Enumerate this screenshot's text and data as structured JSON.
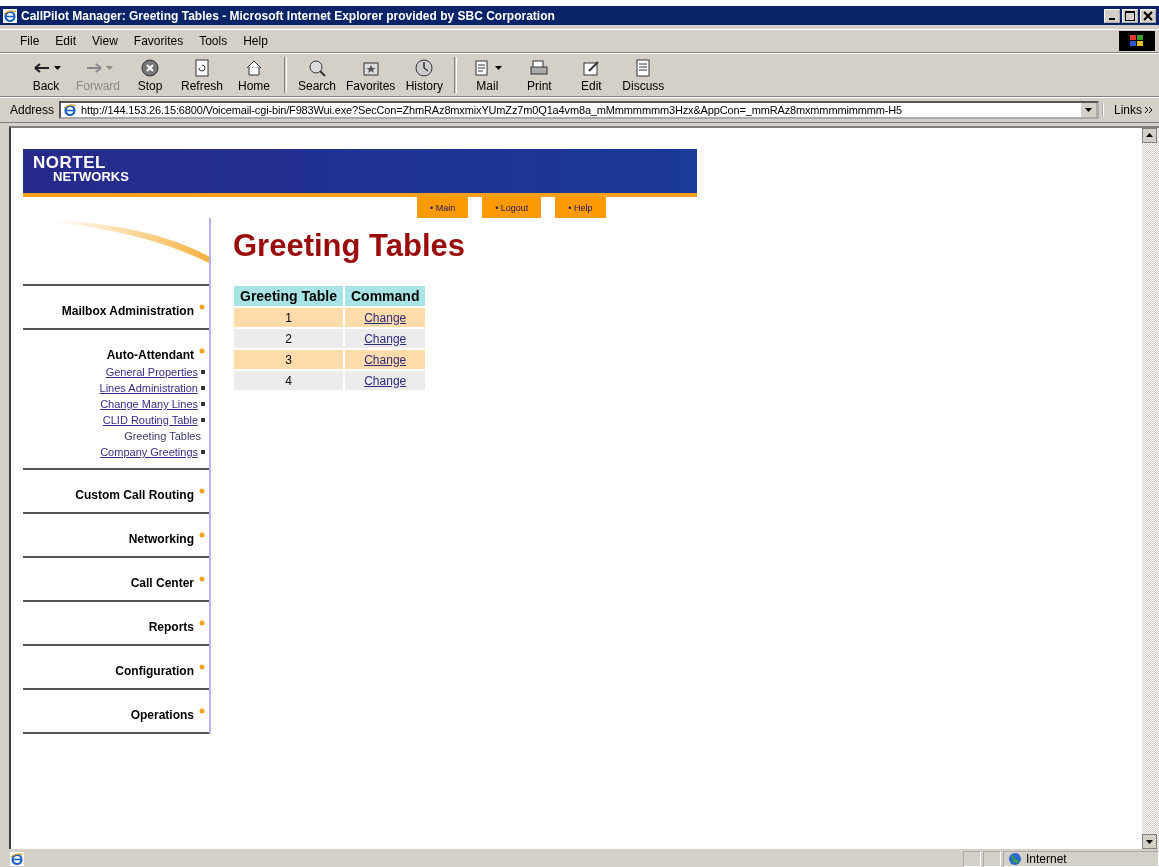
{
  "window": {
    "title": "CallPilot Manager: Greeting Tables - Microsoft Internet Explorer provided by SBC Corporation"
  },
  "menu": [
    {
      "label": "File"
    },
    {
      "label": "Edit"
    },
    {
      "label": "View"
    },
    {
      "label": "Favorites"
    },
    {
      "label": "Tools"
    },
    {
      "label": "Help"
    }
  ],
  "toolbar": [
    {
      "label": "Back",
      "kind": "back",
      "disabled": false,
      "dropdown": true
    },
    {
      "label": "Forward",
      "kind": "forward",
      "disabled": true,
      "dropdown": true
    },
    {
      "label": "Stop",
      "kind": "stop",
      "disabled": false,
      "dropdown": false
    },
    {
      "label": "Refresh",
      "kind": "refresh",
      "disabled": false,
      "dropdown": false
    },
    {
      "label": "Home",
      "kind": "home",
      "disabled": false,
      "dropdown": false
    },
    {
      "label": "Search",
      "kind": "search",
      "disabled": false,
      "dropdown": false
    },
    {
      "label": "Favorites",
      "kind": "favorites",
      "disabled": false,
      "dropdown": false
    },
    {
      "label": "History",
      "kind": "history",
      "disabled": false,
      "dropdown": false
    },
    {
      "label": "Mail",
      "kind": "mail",
      "disabled": false,
      "dropdown": true
    },
    {
      "label": "Print",
      "kind": "print",
      "disabled": false,
      "dropdown": false
    },
    {
      "label": "Edit",
      "kind": "edit",
      "disabled": false,
      "dropdown": false
    },
    {
      "label": "Discuss",
      "kind": "discuss",
      "disabled": false,
      "dropdown": false
    }
  ],
  "address": {
    "label": "Address",
    "value": "http://144.153.26.15:6800/Voicemail-cgi-bin/F983Wui.exe?SecCon=ZhmRAz8mxmixYUmZz7m0Q1a4vm8a_mMmmmmmm3Hzx&AppCon=_mmRAz8mxmmmmimmmm-H5",
    "links": "Links"
  },
  "banner": {
    "logo_top": "NORTEL",
    "logo_bottom": "NETWORKS"
  },
  "nav": [
    {
      "label": "• Main"
    },
    {
      "label": "• Logout"
    },
    {
      "label": "• Help"
    }
  ],
  "sidebar": {
    "items": [
      {
        "label": "Mailbox Administration"
      },
      {
        "label": "Auto-Attendant",
        "children": [
          {
            "label": "General Properties",
            "selected": false
          },
          {
            "label": "Lines Administration",
            "selected": false
          },
          {
            "label": "Change Many Lines",
            "selected": false
          },
          {
            "label": "CLID Routing Table",
            "selected": false
          },
          {
            "label": "Greeting Tables",
            "selected": true
          },
          {
            "label": "Company Greetings",
            "selected": false
          }
        ]
      },
      {
        "label": "Custom Call Routing"
      },
      {
        "label": "Networking"
      },
      {
        "label": "Call Center"
      },
      {
        "label": "Reports"
      },
      {
        "label": "Configuration"
      },
      {
        "label": "Operations"
      }
    ]
  },
  "heading": "Greeting Tables",
  "table": {
    "columns": [
      "Greeting Table",
      "Command"
    ],
    "rows": [
      [
        "1",
        "Change"
      ],
      [
        "2",
        "Change"
      ],
      [
        "3",
        "Change"
      ],
      [
        "4",
        "Change"
      ]
    ]
  },
  "status_bar": {
    "zone": "Internet"
  }
}
